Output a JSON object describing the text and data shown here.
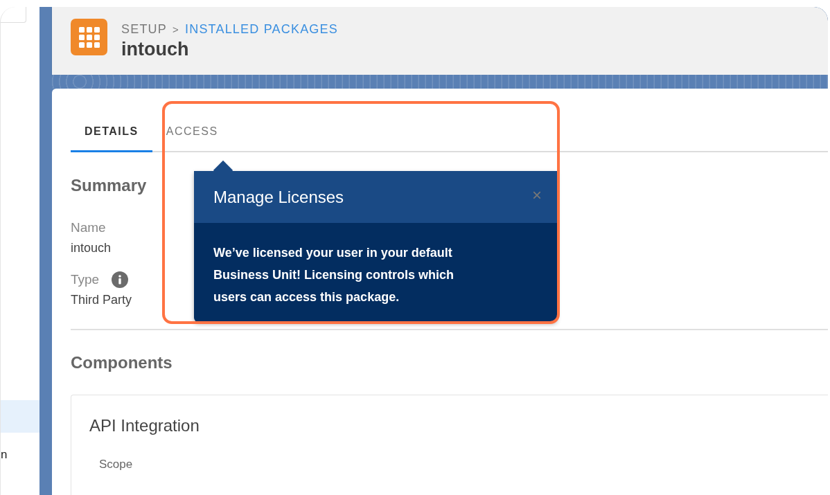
{
  "sidebar": {
    "items": [
      {
        "selected": true
      },
      {
        "label": "n",
        "selected": false
      }
    ]
  },
  "breadcrumb": {
    "parent": "SETUP",
    "separator": ">",
    "current": "INSTALLED PACKAGES"
  },
  "title": "intouch",
  "tabs": [
    {
      "label": "DETAILS",
      "selected": true
    },
    {
      "label": "ACCESS",
      "selected": false
    }
  ],
  "summary": {
    "heading": "Summary",
    "fields": [
      {
        "label": "Name",
        "value": "intouch",
        "info": false
      },
      {
        "label": "Type",
        "value": "Third Party",
        "info": true
      }
    ]
  },
  "components": {
    "heading": "Components",
    "cards": [
      {
        "title": "API Integration",
        "field_label": "Scope"
      }
    ]
  },
  "popover": {
    "title": "Manage Licenses",
    "close": "×",
    "body": "We’ve licensed your user in your default Business Unit! Licensing controls which users can access this package."
  }
}
